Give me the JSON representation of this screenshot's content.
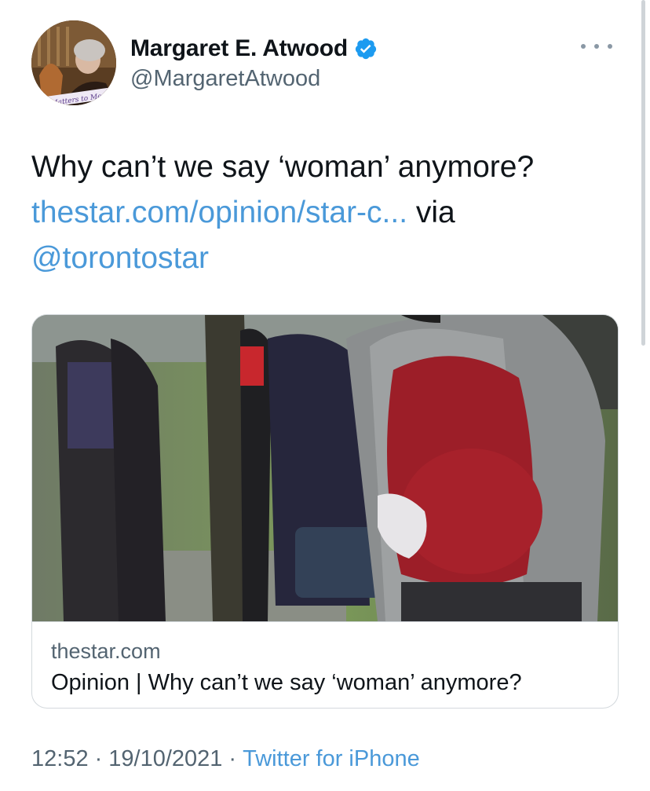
{
  "author": {
    "display_name": "Margaret E. Atwood",
    "handle": "@MargaretAtwood",
    "avatar_caption": "It Matters to Me"
  },
  "tweet": {
    "text": "Why can’t we say ‘woman’ anymore?",
    "link_text": "thestar.com/opinion/star-c...",
    "via_text": "via",
    "mention": "@torontostar"
  },
  "card": {
    "domain": "thestar.com",
    "title": "Opinion | Why can’t we say ‘woman’ anymore?"
  },
  "meta": {
    "time": "12:52",
    "date": "19/10/2021",
    "separator": "·",
    "source": "Twitter for iPhone"
  },
  "icons": {
    "verified": "verified-badge-icon",
    "more": "more-options-icon"
  },
  "colors": {
    "link": "#4a99d9",
    "verified": "#1d9bf0",
    "secondary_text": "#536471"
  }
}
